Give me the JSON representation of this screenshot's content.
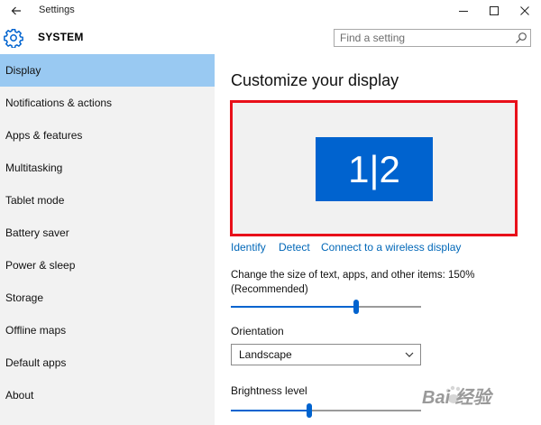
{
  "window": {
    "title": "Settings"
  },
  "header": {
    "section_title": "SYSTEM",
    "search_placeholder": "Find a setting"
  },
  "sidebar": {
    "items": [
      {
        "label": "Display",
        "active": true
      },
      {
        "label": "Notifications & actions",
        "active": false
      },
      {
        "label": "Apps & features",
        "active": false
      },
      {
        "label": "Multitasking",
        "active": false
      },
      {
        "label": "Tablet mode",
        "active": false
      },
      {
        "label": "Battery saver",
        "active": false
      },
      {
        "label": "Power & sleep",
        "active": false
      },
      {
        "label": "Storage",
        "active": false
      },
      {
        "label": "Offline maps",
        "active": false
      },
      {
        "label": "Default apps",
        "active": false
      },
      {
        "label": "About",
        "active": false
      }
    ]
  },
  "main": {
    "title": "Customize your display",
    "monitor_label": "1|2",
    "links": {
      "identify": "Identify",
      "detect": "Detect",
      "wireless": "Connect to a wireless display"
    },
    "scale": {
      "label": "Change the size of text, apps, and other items: 150% (Recommended)",
      "value_fraction": 0.66
    },
    "orientation": {
      "label": "Orientation",
      "value": "Landscape"
    },
    "brightness": {
      "label": "Brightness level",
      "value_fraction": 0.41
    }
  },
  "watermark": {
    "text": "Bai 经验"
  },
  "colors": {
    "accent": "#0063cf",
    "sidebar_bg": "#f2f2f2",
    "sidebar_active": "#99c9f2",
    "highlight_border": "#e8101a",
    "link": "#0067b8"
  }
}
